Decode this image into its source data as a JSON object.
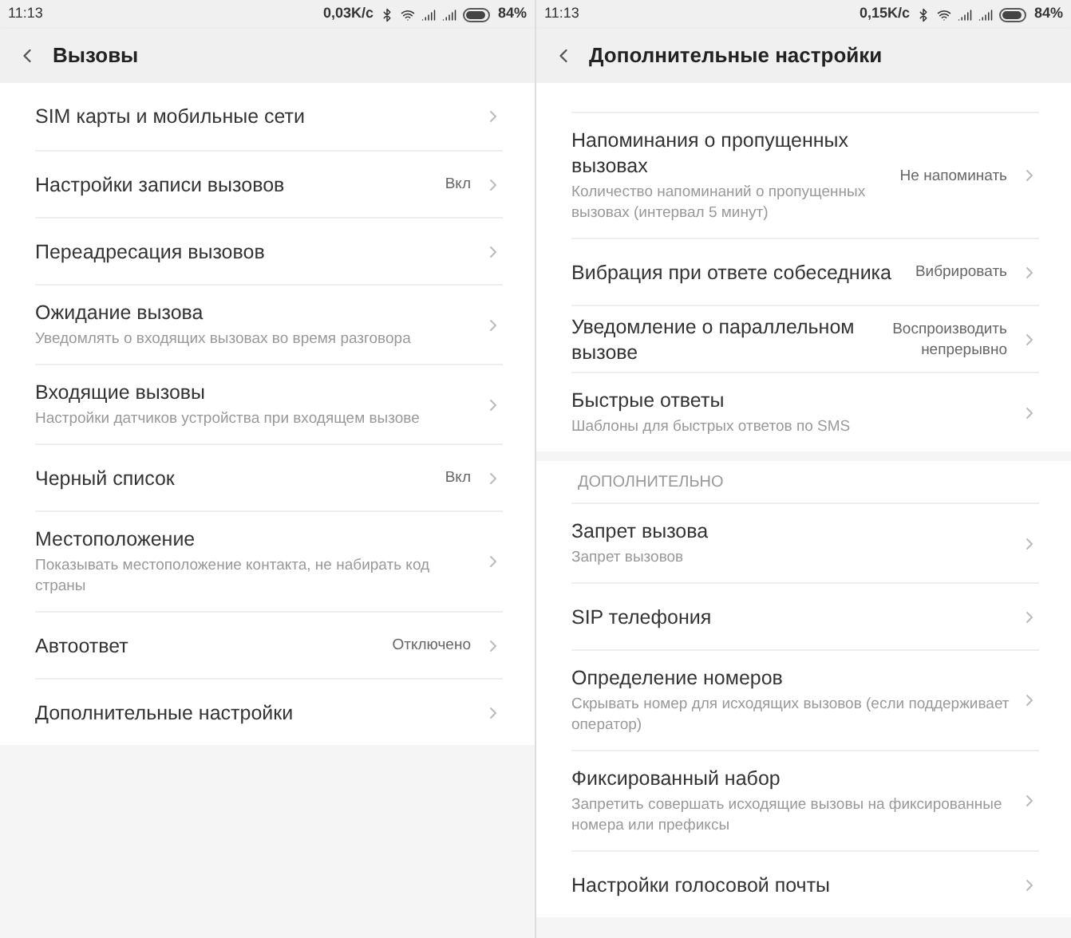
{
  "screens": [
    {
      "status_bar": {
        "time": "11:13",
        "speed": "0,03K/c",
        "battery": "84%"
      },
      "title": "Вызовы",
      "groups": [
        {
          "items": [
            {
              "title": "SIM карты и мобильные сети"
            },
            {
              "title": "Настройки записи вызовов",
              "value": "Вкл"
            },
            {
              "title": "Переадресация вызовов"
            },
            {
              "title": "Ожидание вызова",
              "subtitle": "Уведомлять о входящих вызовах во время разговора"
            },
            {
              "title": "Входящие вызовы",
              "subtitle": "Настройки датчиков устройства при входящем вызове"
            },
            {
              "title": "Черный список",
              "value": "Вкл"
            },
            {
              "title": "Местоположение",
              "subtitle": "Показывать местоположение контакта, не набирать код страны"
            },
            {
              "title": "Автоответ",
              "value": "Отключено"
            },
            {
              "title": "Дополнительные настройки"
            }
          ]
        }
      ]
    },
    {
      "status_bar": {
        "time": "11:13",
        "speed": "0,15K/c",
        "battery": "84%"
      },
      "title": "Дополнительные настройки",
      "groups": [
        {
          "items": [
            {
              "title": "Напоминания о пропущенных вызовах",
              "subtitle": "Количество напоминаний о пропущенных вызовах (интервал 5 минут)",
              "value": "Не напоминать"
            },
            {
              "title": "Вибрация при ответе собеседника",
              "value": "Вибрировать"
            },
            {
              "title": "Уведомление о параллельном вызове",
              "value": "Воспроизводить\nнепрерывно"
            },
            {
              "title": "Быстрые ответы",
              "subtitle": "Шаблоны для быстрых ответов по SMS"
            }
          ]
        },
        {
          "header": "ДОПОЛНИТЕЛЬНО",
          "items": [
            {
              "title": "Запрет вызова",
              "subtitle": "Запрет вызовов"
            },
            {
              "title": "SIP телефония"
            },
            {
              "title": "Определение номеров",
              "subtitle": "Скрывать номер для исходящих вызовов (если поддерживает оператор)"
            },
            {
              "title": "Фиксированный набор",
              "subtitle": "Запретить совершать исходящие вызовы на фиксированные номера или префиксы"
            },
            {
              "title": "Настройки голосовой почты"
            }
          ]
        }
      ]
    }
  ]
}
